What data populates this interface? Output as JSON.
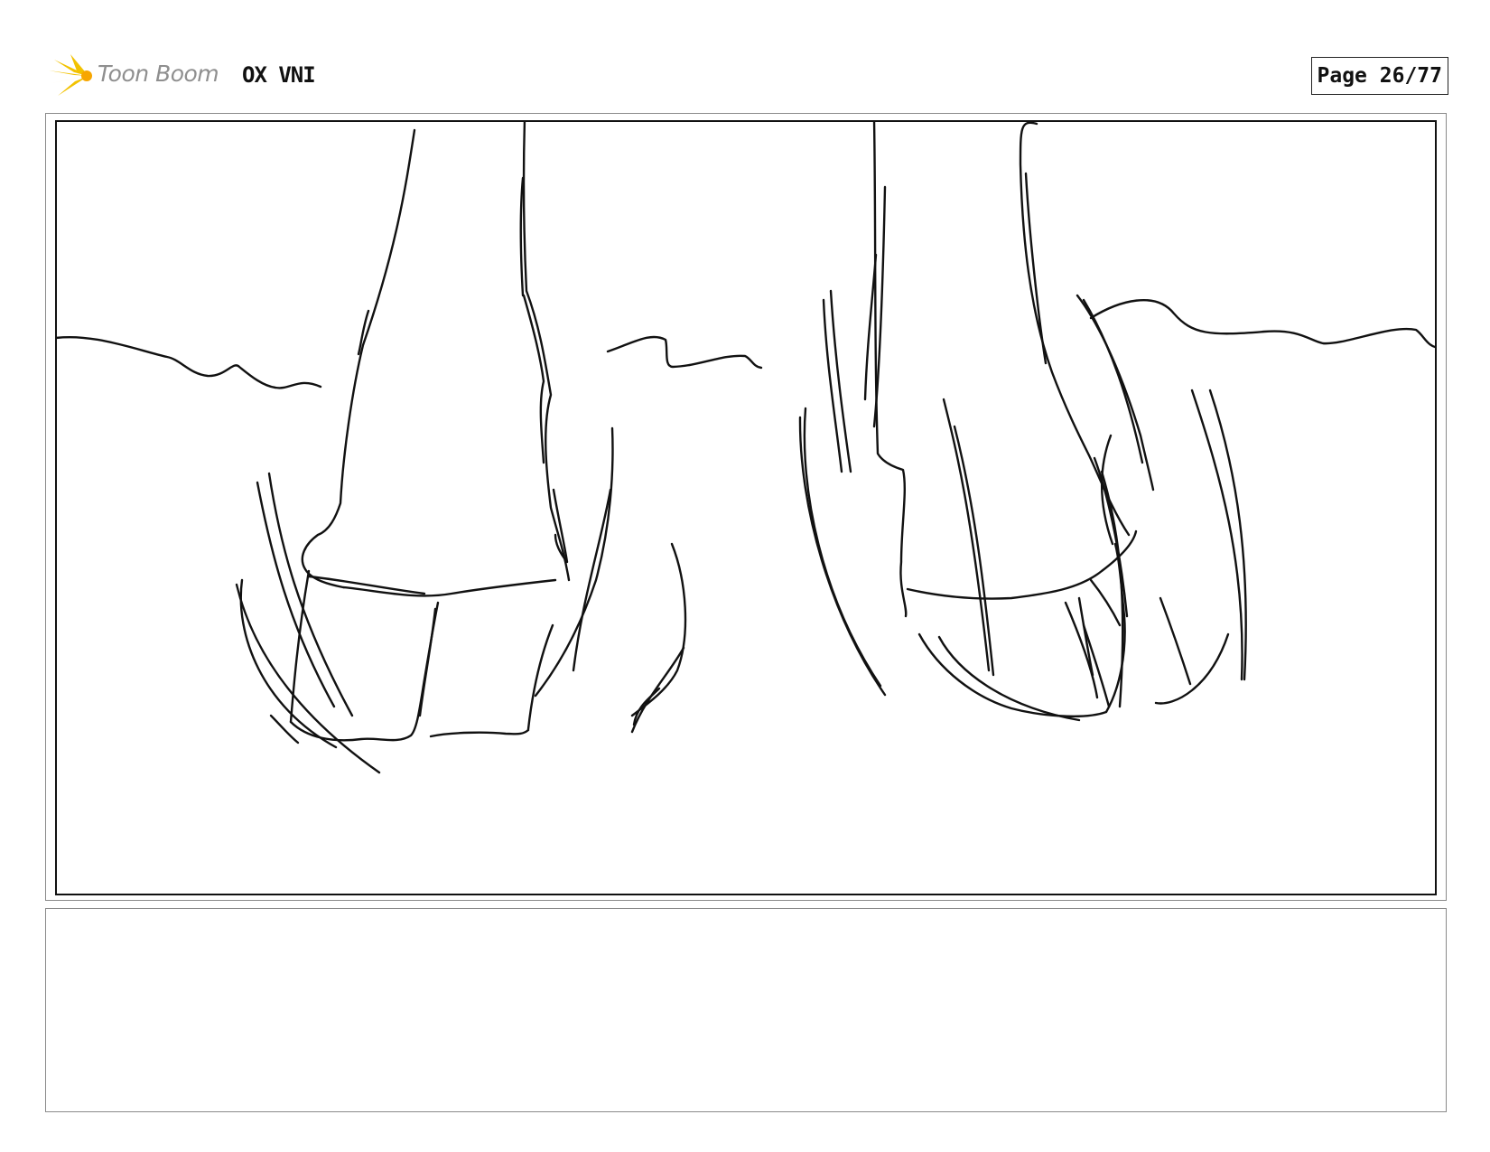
{
  "header": {
    "logo": {
      "brand": "Toon Boom",
      "icon": "sunburst-logo-icon",
      "accent_color": "#f2c200"
    },
    "project_title": "OX VNI",
    "page_label": "Page 26/77"
  },
  "panel": {
    "drawing": "sketch of two hooved legs standing on a horizon line",
    "line_color": "#111111"
  },
  "notes": {
    "text": ""
  }
}
